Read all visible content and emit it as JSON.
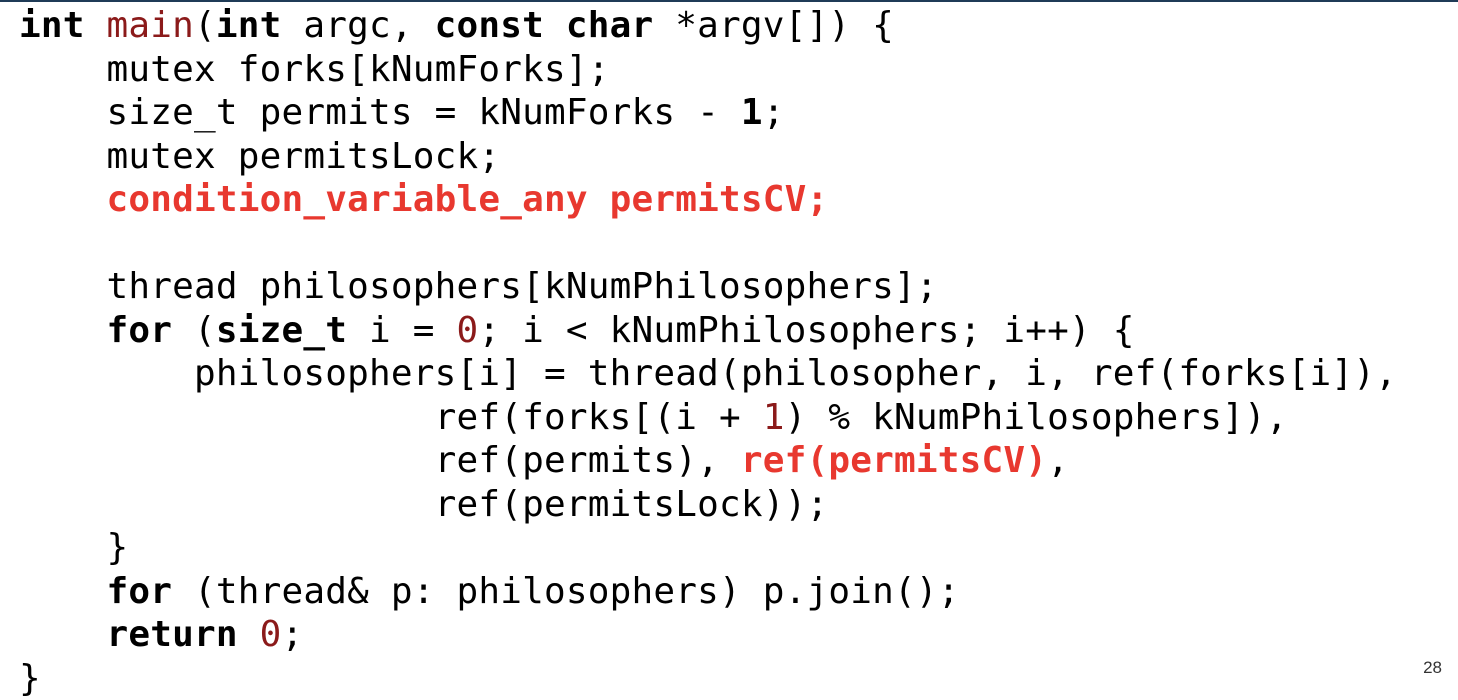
{
  "colors": {
    "rule": "#1f3b57",
    "text": "#000000",
    "function_and_number": "#8b1a1a",
    "highlight": "#e8382f"
  },
  "code_lines": [
    [
      {
        "t": "int",
        "k": "kw"
      },
      {
        "t": " "
      },
      {
        "t": "main",
        "k": "fn"
      },
      {
        "t": "("
      },
      {
        "t": "int",
        "k": "kw"
      },
      {
        "t": " argc, "
      },
      {
        "t": "const",
        "k": "kw"
      },
      {
        "t": " "
      },
      {
        "t": "char",
        "k": "kw"
      },
      {
        "t": " *argv[]) {"
      }
    ],
    [
      {
        "t": "    mutex forks[kNumForks];"
      }
    ],
    [
      {
        "t": "    size_t permits = kNumForks - "
      },
      {
        "t": "1",
        "k": "kw"
      },
      {
        "t": ";"
      }
    ],
    [
      {
        "t": "    mutex permitsLock;"
      }
    ],
    [
      {
        "t": "    "
      },
      {
        "t": "condition_variable_any permitsCV;",
        "k": "hl"
      }
    ],
    [],
    [
      {
        "t": "    thread philosophers[kNumPhilosophers];"
      }
    ],
    [
      {
        "t": "    "
      },
      {
        "t": "for",
        "k": "kw"
      },
      {
        "t": " ("
      },
      {
        "t": "size_t",
        "k": "kw"
      },
      {
        "t": " i = "
      },
      {
        "t": "0",
        "k": "num"
      },
      {
        "t": "; i < kNumPhilosophers; i++) {"
      }
    ],
    [
      {
        "t": "        philosophers[i] = thread(philosopher, i, ref(forks[i]),"
      }
    ],
    [
      {
        "t": "                   ref(forks[(i + "
      },
      {
        "t": "1",
        "k": "num"
      },
      {
        "t": ") % kNumPhilosophers]),"
      }
    ],
    [
      {
        "t": "                   ref(permits), "
      },
      {
        "t": "ref(permitsCV)",
        "k": "hl"
      },
      {
        "t": ","
      }
    ],
    [
      {
        "t": "                   ref(permitsLock));"
      }
    ],
    [
      {
        "t": "    }"
      }
    ],
    [
      {
        "t": "    "
      },
      {
        "t": "for",
        "k": "kw"
      },
      {
        "t": " (thread& p: philosophers) p.join();"
      }
    ],
    [
      {
        "t": "    "
      },
      {
        "t": "return",
        "k": "kw"
      },
      {
        "t": " "
      },
      {
        "t": "0",
        "k": "num"
      },
      {
        "t": ";"
      }
    ],
    [
      {
        "t": "}"
      }
    ]
  ],
  "page_number": "28"
}
